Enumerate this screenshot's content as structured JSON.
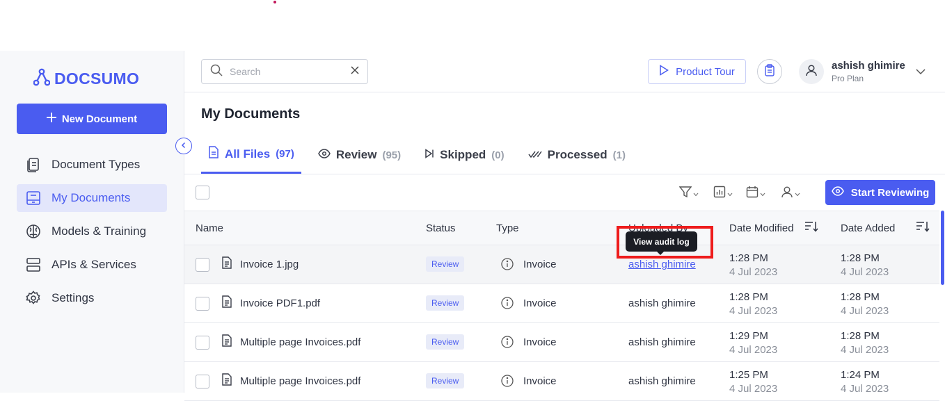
{
  "brand": {
    "logo_text": "DOCSUMO",
    "accent": "#4a5cf0"
  },
  "sidebar": {
    "new_document_label": "New Document",
    "items": [
      {
        "label": "Document Types",
        "icon": "document-types-icon"
      },
      {
        "label": "My Documents",
        "icon": "my-documents-icon",
        "active": true
      },
      {
        "label": "Models & Training",
        "icon": "models-brain-icon"
      },
      {
        "label": "APIs & Services",
        "icon": "server-icon"
      },
      {
        "label": "Settings",
        "icon": "gear-icon"
      }
    ]
  },
  "header": {
    "search_placeholder": "Search",
    "product_tour_label": "Product Tour",
    "user": {
      "name": "ashish ghimire",
      "plan": "Pro Plan"
    }
  },
  "main": {
    "title": "My Documents",
    "tabs": [
      {
        "label": "All Files",
        "count": "(97)",
        "active": true
      },
      {
        "label": "Review",
        "count": "(95)"
      },
      {
        "label": "Skipped",
        "count": "(0)"
      },
      {
        "label": "Processed",
        "count": "(1)"
      }
    ],
    "start_reviewing_label": "Start Reviewing",
    "columns": {
      "name": "Name",
      "status": "Status",
      "type": "Type",
      "uploaded_by": "Uploaded By",
      "date_modified": "Date Modified",
      "date_added": "Date Added"
    },
    "rows": [
      {
        "name": "Invoice 1.jpg",
        "status": "Review",
        "type": "Invoice",
        "uploaded_by": "ashish ghimire",
        "modified_time": "1:28 PM",
        "modified_date": "4 Jul 2023",
        "added_time": "1:28 PM",
        "added_date": "4 Jul 2023"
      },
      {
        "name": "Invoice PDF1.pdf",
        "status": "Review",
        "type": "Invoice",
        "uploaded_by": "ashish ghimire",
        "modified_time": "1:28 PM",
        "modified_date": "4 Jul 2023",
        "added_time": "1:28 PM",
        "added_date": "4 Jul 2023"
      },
      {
        "name": "Multiple page Invoices.pdf",
        "status": "Review",
        "type": "Invoice",
        "uploaded_by": "ashish ghimire",
        "modified_time": "1:29 PM",
        "modified_date": "4 Jul 2023",
        "added_time": "1:28 PM",
        "added_date": "4 Jul 2023"
      },
      {
        "name": "Multiple page Invoices.pdf",
        "status": "Review",
        "type": "Invoice",
        "uploaded_by": "ashish ghimire",
        "modified_time": "1:25 PM",
        "modified_date": "4 Jul 2023",
        "added_time": "1:24 PM",
        "added_date": "4 Jul 2023"
      }
    ],
    "tooltip": "View audit log"
  }
}
